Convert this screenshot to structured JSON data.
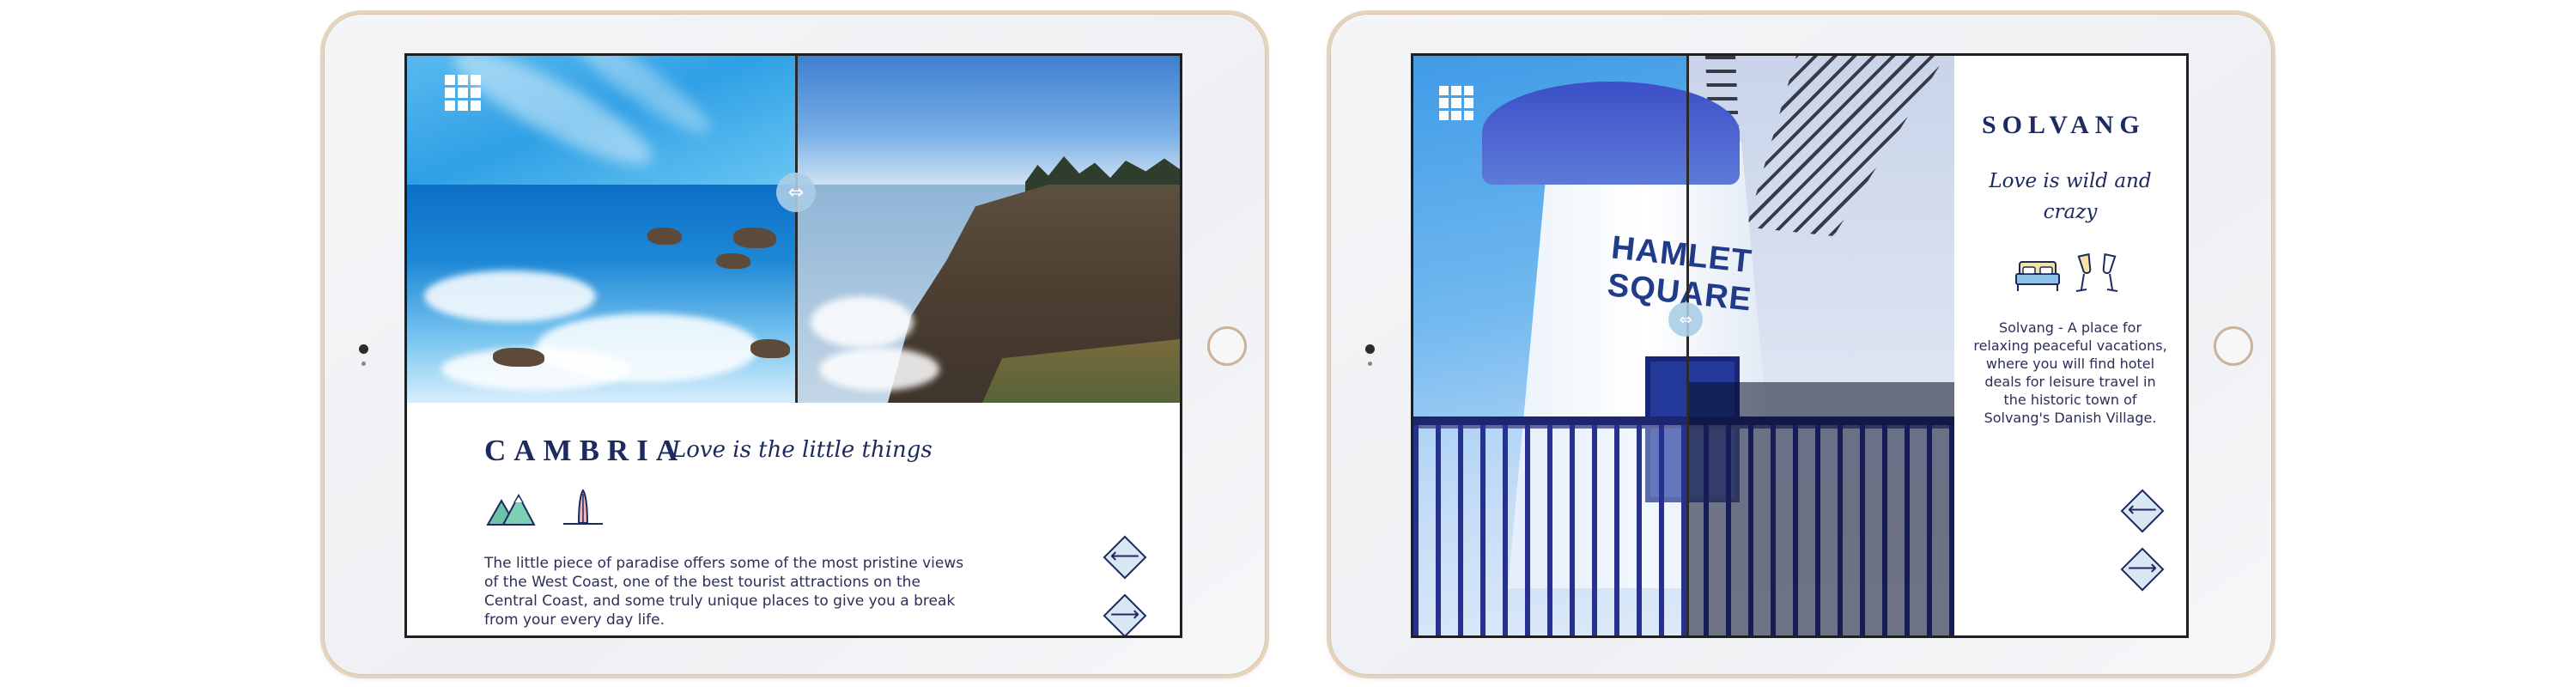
{
  "left_device": {
    "city": "CAMBRIA",
    "tagline": "Love is the little things",
    "description": "The little piece of paradise offers some of the most pristine views of the West Coast, one of the best tourist attractions on the Central Coast, and some truly unique places to give you a break from your every day life.",
    "icons": [
      "mountains-icon",
      "surfboard-icon"
    ],
    "slider_handle_icon": "⇔",
    "prev_arrow": "⟵",
    "next_arrow": "⟶"
  },
  "right_device": {
    "city": "SOLVANG",
    "tagline": "Love is wild and crazy",
    "description": "Solvang - A place for relaxing peaceful vacations, where you will find hotel deals for leisure travel in the historic town of Solvang's Danish Village.",
    "icons": [
      "bed-icon",
      "champagne-glasses-icon"
    ],
    "sign_text_line1": "HAMLET",
    "sign_text_line2": "SQUARE",
    "slider_handle_icon": "⇔",
    "prev_arrow": "⟵",
    "next_arrow": "⟶"
  },
  "colors": {
    "brand_navy": "#1d2a60",
    "bezel_gold": "#e6d3be",
    "nav_button_fill": "#d9e7f4"
  }
}
